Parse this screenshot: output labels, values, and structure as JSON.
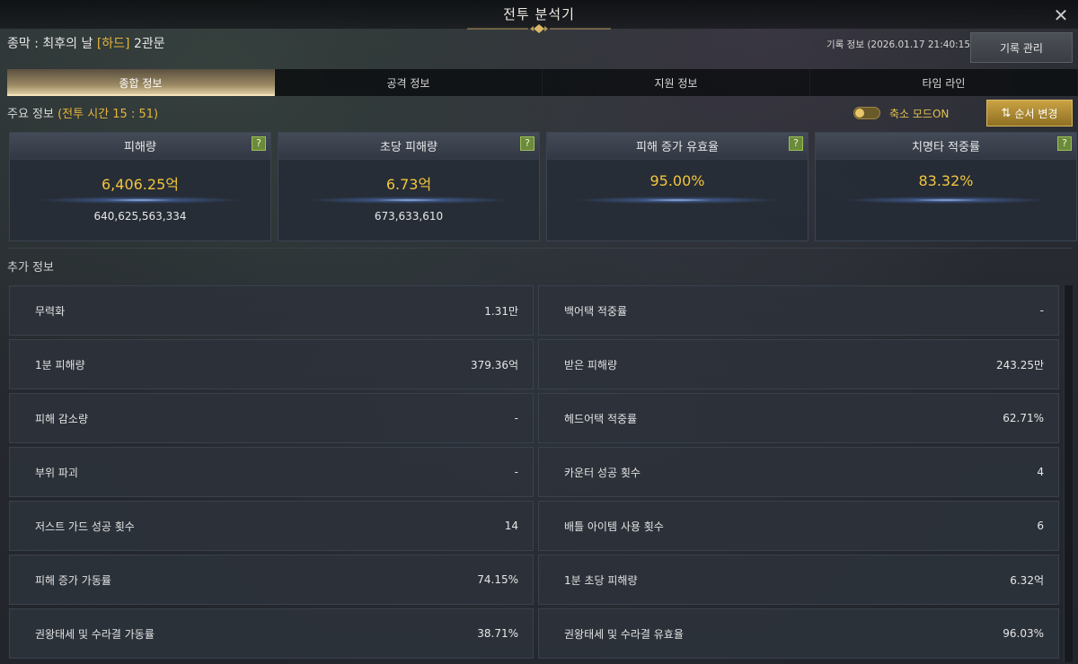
{
  "window": {
    "title": "전투 분석기",
    "close_glyph": "✕"
  },
  "header": {
    "dungeon_prefix": "종막 : 최후의 날 ",
    "difficulty": "[하드]",
    "stage": " 2관문",
    "record_info": "기록 정보 (2026.01.17 21:40:15)",
    "record_button": "기록 관리"
  },
  "tabs": [
    {
      "label": "종합 정보",
      "active": true
    },
    {
      "label": "공격 정보",
      "active": false
    },
    {
      "label": "지원 정보",
      "active": false
    },
    {
      "label": "타임 라인",
      "active": false
    }
  ],
  "main_info": {
    "label": "주요 정보 ",
    "battle_time": "(전투 시간 15 : 51)",
    "toggle_label": "축소 모드ON",
    "toggle_on": true,
    "order_button": "순서 변경"
  },
  "cards": [
    {
      "title": "피해량",
      "main": "6,406.25억",
      "sub": "640,625,563,334"
    },
    {
      "title": "초당 피해량",
      "main": "6.73억",
      "sub": "673,633,610"
    },
    {
      "title": "피해 증가 유효율",
      "main": "95.00%",
      "sub": ""
    },
    {
      "title": "치명타 적중률",
      "main": "83.32%",
      "sub": ""
    }
  ],
  "help_glyph": "?",
  "extra_info": {
    "label": "추가 정보",
    "left": [
      {
        "label": "무력화",
        "value": "1.31만"
      },
      {
        "label": "1분 피해량",
        "value": "379.36억"
      },
      {
        "label": "피해 감소량",
        "value": "-"
      },
      {
        "label": "부위 파괴",
        "value": "-"
      },
      {
        "label": "저스트 가드 성공 횟수",
        "value": "14"
      },
      {
        "label": "피해 증가 가동률",
        "value": "74.15%"
      },
      {
        "label": "권왕태세 및 수라결 가동률",
        "value": "38.71%"
      }
    ],
    "right": [
      {
        "label": "백어택 적중률",
        "value": "-"
      },
      {
        "label": "받은 피해량",
        "value": "243.25만"
      },
      {
        "label": "헤드어택 적중률",
        "value": "62.71%"
      },
      {
        "label": "카운터 성공 횟수",
        "value": "4"
      },
      {
        "label": "배틀 아이템 사용 횟수",
        "value": "6"
      },
      {
        "label": "1분 초당 피해량",
        "value": "6.32억"
      },
      {
        "label": "권왕태세 및 수라결 유효율",
        "value": "96.03%"
      }
    ]
  },
  "colors": {
    "accent_gold": "#f2c53d",
    "difficulty": "#e5b53a",
    "help_green": "#6b8a3a"
  }
}
